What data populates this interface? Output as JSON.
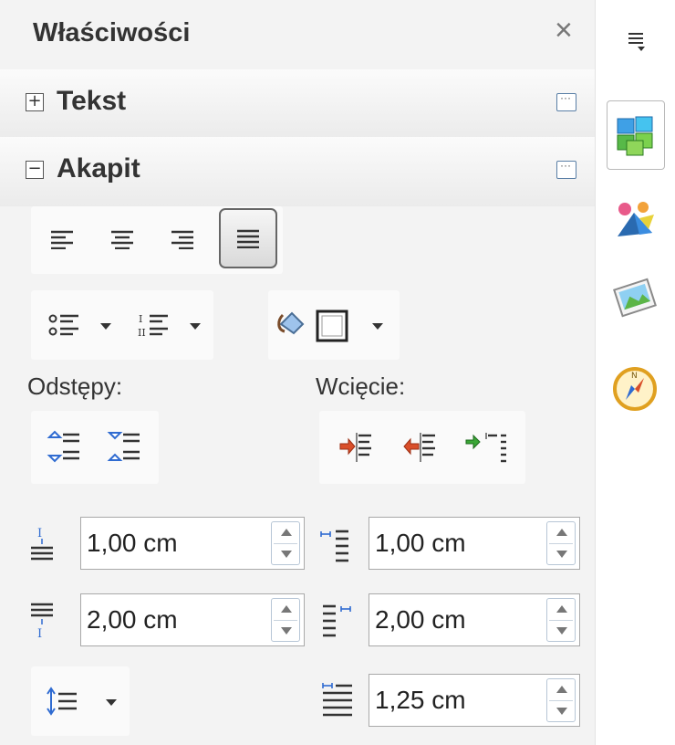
{
  "panel": {
    "title": "Właściwości",
    "close_icon": "×",
    "sections": {
      "text": {
        "expander": "+",
        "label": "Tekst"
      },
      "paragraph": {
        "expander": "−",
        "label": "Akapit"
      }
    },
    "spacing_label": "Odstępy:",
    "indent_label": "Wcięcie:",
    "fields": {
      "above_spacing": "1,00 cm",
      "below_spacing": "2,00 cm",
      "before_indent": "1,00 cm",
      "after_indent": "2,00 cm",
      "first_line_indent": "1,25 cm"
    }
  },
  "icons": {
    "align": [
      "align-left-icon",
      "align-center-icon",
      "align-right-icon",
      "align-justify-icon"
    ],
    "rail": [
      "properties-deck-icon",
      "styles-icon",
      "gallery-icon",
      "navigator-icon"
    ]
  },
  "colors": {
    "accent_red": "#d94f2a",
    "accent_green": "#3aa636",
    "accent_blue": "#2f6bd1"
  }
}
